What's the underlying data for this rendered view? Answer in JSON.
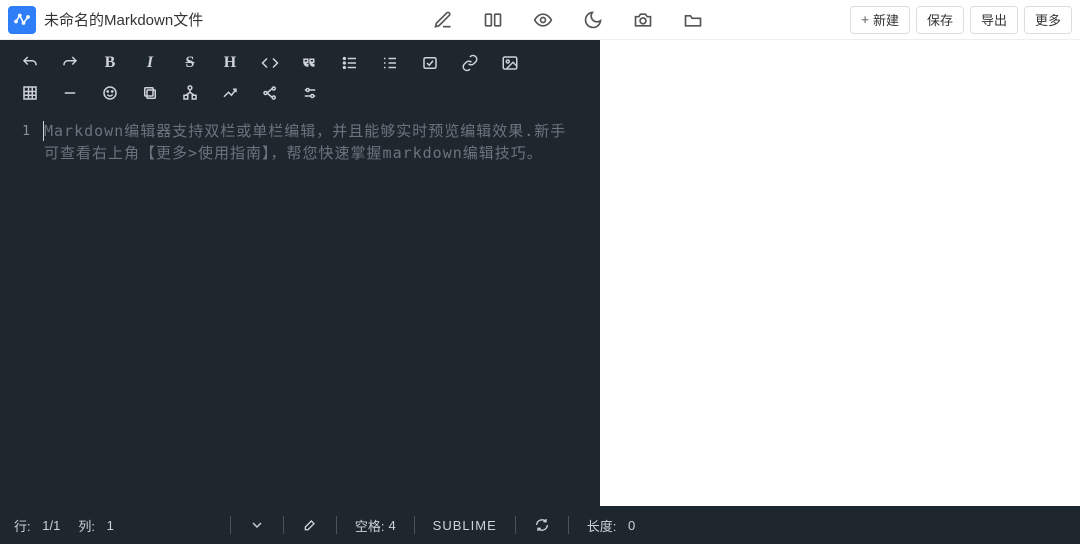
{
  "header": {
    "title": "未命名的Markdown文件",
    "buttons": {
      "new": "新建",
      "save": "保存",
      "export": "导出",
      "more": "更多"
    }
  },
  "editor": {
    "placeholder": "Markdown编辑器支持双栏或单栏编辑，并且能够实时预览编辑效果.新手可查看右上角【更多>使用指南】，帮您快速掌握markdown编辑技巧。",
    "gutter": {
      "line1": "1"
    }
  },
  "status": {
    "row_label": "行:",
    "row_value": "1/1",
    "col_label": "列:",
    "col_value": "1",
    "spaces_label": "空格:",
    "spaces_value": "4",
    "mode": "SUBLIME",
    "length_label": "长度:",
    "length_value": "0"
  }
}
